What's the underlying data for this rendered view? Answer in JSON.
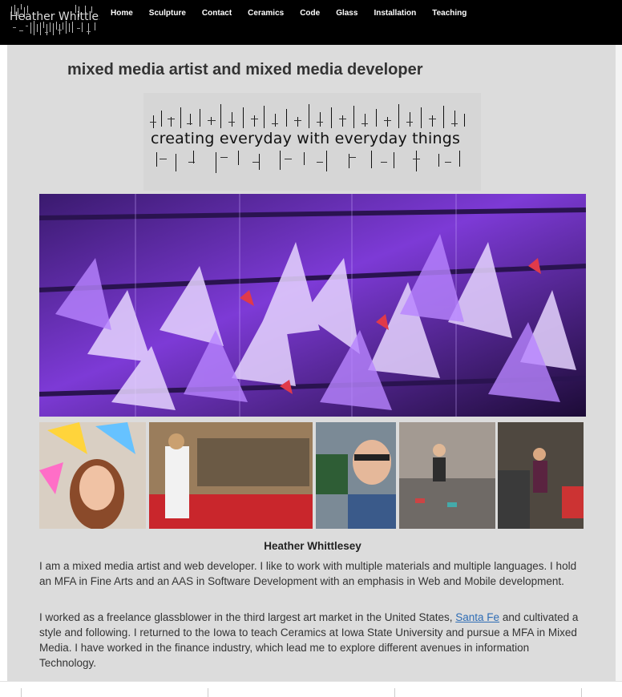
{
  "site": {
    "logo_text": "Heather Whittlesey"
  },
  "nav": {
    "items": [
      {
        "label": "Home"
      },
      {
        "label": "Sculpture"
      },
      {
        "label": "Contact"
      },
      {
        "label": "Ceramics"
      },
      {
        "label": "Code"
      },
      {
        "label": "Glass"
      },
      {
        "label": "Installation"
      },
      {
        "label": "Teaching"
      }
    ]
  },
  "main": {
    "headline": "mixed media artist and mixed media developer",
    "tagline": "creating everyday with everyday things",
    "name": "Heather Whittlesey",
    "p1": "I am a mixed media artist and web developer. I like to work with multiple materials and multiple languages. I hold an MFA in Fine Arts and an AAS in Software Development with an emphasis in Web and Mobile development.",
    "p2_before": "I worked as a freelance glassblower in the third largest art market in the United States, ",
    "p2_link": "Santa Fe",
    "p2_after": " and cultivated a style and following. I returned to the Iowa to teach Ceramics at Iowa State University and pursue a MFA in Mixed Media. I have worked in the finance industry, which lead me to explore different avenues in information Technology."
  },
  "colors": {
    "nav_bg": "#000000",
    "panel_bg": "#dcdcdc",
    "link": "#2f6db5",
    "hero_accent": "#9b5cff"
  }
}
